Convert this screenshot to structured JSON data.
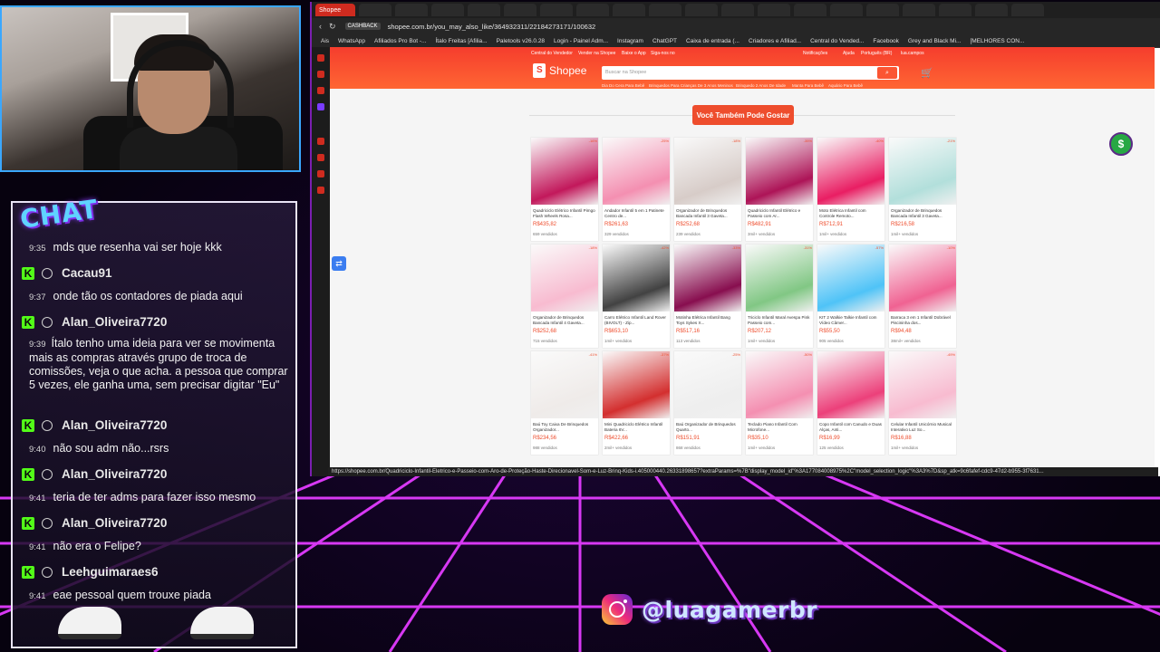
{
  "stream": {
    "chat_logo": "CHAT",
    "instagram_handle": "@luagamerbr"
  },
  "chat": {
    "messages": [
      {
        "time": "9:35",
        "text": "mds que resenha vai ser hoje kkk"
      },
      {
        "user": "Cacau91",
        "time": "9:37",
        "text": "onde tão os contadores de piada aqui"
      },
      {
        "user": "Alan_Oliveira7720",
        "time": "9:39",
        "text": "Ítalo tenho uma ideia para ver se movimenta mais as compras através grupo de troca de comissões, veja o que acha. a pessoa que comprar 5 vezes, ele ganha uma, sem precisar digitar \"Eu\""
      },
      {
        "user": "Alan_Oliveira7720",
        "time": "9:40",
        "text": "não sou adm não...rsrs"
      },
      {
        "user": "Alan_Oliveira7720",
        "time": "9:41",
        "text": "teria de ter adms para fazer isso mesmo"
      },
      {
        "user": "Alan_Oliveira7720",
        "time": "9:41",
        "text": "não era o Felipe?"
      },
      {
        "user": "Leehguimaraes6",
        "time": "9:41",
        "text": "eae pessoal quem trouxe piada"
      }
    ]
  },
  "browser": {
    "active_tab": "Shopee",
    "url": "shopee.com.br/you_may_also_like/364932311/22184273171/100632",
    "cashback_label": "CASHBACK",
    "bookmarks": [
      "Ais",
      "WhatsApp",
      "Afiliados Pro Bot -...",
      "Ítalo Freitas [Afilia...",
      "Paletools v26.0.28",
      "Login - Painel Adm...",
      "Instagram",
      "ChatGPT",
      "Caixa de entrada (...",
      "Criadores e Afiliad...",
      "Central do Vended...",
      "Facebook",
      "Grey and Black Mi...",
      "[MELHORES CON..."
    ],
    "status_url": "https://shopee.com.br/Quadriciclo-Infantil-Eletrico-e-Passeio-com-Aro-de-Proteção-Haste-Direcionavel-Som-e-Luz-Brinq-Kids-i.405000440.26331898657?extraParams=%7B\"display_model_id\"%3A177084008975%2C\"model_selection_logic\"%3A3%7D&sp_atk=9c6fafef-cdc9-47d2-b955-3f7631..."
  },
  "shopee": {
    "top_links": [
      "Central do Vendedor",
      "Vender na Shopee",
      "Baixe o App",
      "Siga-nos no"
    ],
    "top_right": [
      "Notificações",
      "Ajuda",
      "Português (BR)",
      "lua.campos"
    ],
    "logo": "Shopee",
    "search_placeholder": "Buscar na Shopee",
    "suggestions": [
      "Dia Do Cera Para Bebê",
      "Brinquedos Para Crianças De 3 Anos Meninos",
      "Brinquedo 2 Anos De Idade",
      "Manta Para Bebê",
      "Aquário Para Bebê"
    ],
    "section_title": "Você Também Pode Gostar",
    "products": [
      {
        "name": "Quadriciclo Elétrico Infantil Pimgo Flash Wheels Rosa...",
        "price": "R$435,82",
        "sold": "659 vendidos",
        "disc": "-16%",
        "color": "#c2185b"
      },
      {
        "name": "Andador Infantil 5 em 1 Patinete Centro de...",
        "price": "R$261,63",
        "sold": "329 vendidos",
        "disc": "-25%",
        "color": "#f48fb1"
      },
      {
        "name": "Organizador de Brinquedos Bancada Infantil 3 Gaveta...",
        "price": "R$252,68",
        "sold": "239 vendidos",
        "disc": "-18%",
        "color": "#d7ccc8"
      },
      {
        "name": "Quadriciclo Infantil Elétrico e Passeio com Ar...",
        "price": "R$482,91",
        "sold": "3mil+ vendidos",
        "disc": "-35%",
        "color": "#ad1457"
      },
      {
        "name": "Moto Elétrica Infantil com Controle Remoto...",
        "price": "R$712,91",
        "sold": "1mil+ vendidos",
        "disc": "-40%",
        "color": "#e91e63"
      },
      {
        "name": "Organizador de Brinquedos Bancada Infantil 3 Gaveta...",
        "price": "R$216,58",
        "sold": "1mil+ vendidos",
        "disc": "-21%",
        "color": "#b2dfdb"
      },
      {
        "name": "Organizador de Brinquedos Bancada Infantil 4 Gaveta...",
        "price": "R$252,68",
        "sold": "715 vendidos",
        "disc": "-18%",
        "color": "#f8bbd0"
      },
      {
        "name": "Carro Elétrico Infantil Land Rover (BIVOLT) - Zip...",
        "price": "R$653,10",
        "sold": "1mil+ vendidos",
        "disc": "-42%",
        "color": "#424242"
      },
      {
        "name": "Motinha Elétrica Infantil Bang Toys Sykes X...",
        "price": "R$517,16",
        "sold": "113 vendidos",
        "disc": "-33%",
        "color": "#880e4f"
      },
      {
        "name": "Triciclo Infantil Maral Avespa Pink Passeio com...",
        "price": "R$207,12",
        "sold": "1mil+ vendidos",
        "disc": "-31%",
        "color": "#81c784"
      },
      {
        "name": "KIT 2 Walkie Talkie Infantil com Vídeo Câmer...",
        "price": "R$55,50",
        "sold": "905 vendidos",
        "disc": "-57%",
        "color": "#4fc3f7"
      },
      {
        "name": "Barraca 3 em 1 Infantil Dobrável Piscininha dos...",
        "price": "R$94,48",
        "sold": "38mil+ vendidos",
        "disc": "-10%",
        "color": "#f06292"
      },
      {
        "name": "Baú Toy Caixa De Brinquedos Organizador...",
        "price": "R$234,56",
        "sold": "988 vendidos",
        "disc": "-41%",
        "color": "#efebe9"
      },
      {
        "name": "Mini Quadriciclo Elétrico Infantil Bateria 6V...",
        "price": "R$422,66",
        "sold": "2mil+ vendidos",
        "disc": "-37%",
        "color": "#d32f2f"
      },
      {
        "name": "Baú Organizador de Brinquedos Quarto...",
        "price": "R$151,91",
        "sold": "868 vendidos",
        "disc": "-25%",
        "color": "#eeeeee"
      },
      {
        "name": "Teclado Piano Infantil Com Microfone...",
        "price": "R$35,10",
        "sold": "1mil+ vendidos",
        "disc": "-50%",
        "color": "#f48fb1"
      },
      {
        "name": "Copo Infantil com Canudo e Duas Alças, Anti...",
        "price": "R$16,99",
        "sold": "125 vendidos",
        "disc": "",
        "color": "#ec407a"
      },
      {
        "name": "Celular Infantil Unicórnio Musical Interativo Luz So...",
        "price": "R$16,88",
        "sold": "1mil+ vendidos",
        "disc": "-49%",
        "color": "#f8bbd0"
      }
    ]
  },
  "colors": {
    "shopee_orange": "#ee4d2d",
    "kick_green": "#53fc18",
    "neon_pink": "#ff2bd6"
  }
}
